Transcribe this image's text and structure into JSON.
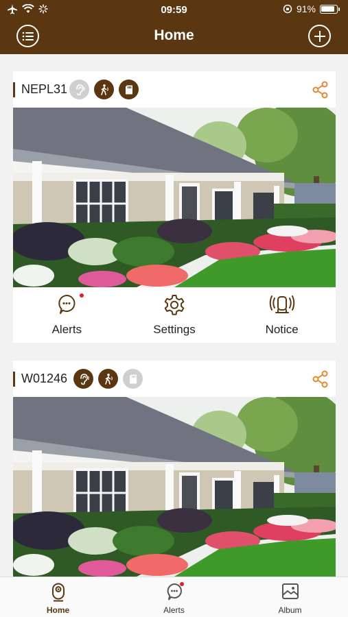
{
  "status_bar": {
    "time": "09:59",
    "battery": "91%"
  },
  "header": {
    "title": "Home"
  },
  "devices": [
    {
      "name": "NEPL31",
      "badges": {
        "sound": "off",
        "motion": "on",
        "storage": "on"
      },
      "actions": [
        {
          "label": "Alerts",
          "icon": "alert-bubble-icon",
          "unread": true
        },
        {
          "label": "Settings",
          "icon": "gear-icon",
          "unread": false
        },
        {
          "label": "Notice",
          "icon": "siren-icon",
          "unread": false
        }
      ]
    },
    {
      "name": "W01246",
      "badges": {
        "sound": "on",
        "motion": "on",
        "storage": "off"
      }
    }
  ],
  "tabbar": [
    {
      "label": "Home",
      "icon": "camera-icon",
      "active": true
    },
    {
      "label": "Alerts",
      "icon": "alert-bubble-icon",
      "unread": true
    },
    {
      "label": "Album",
      "icon": "album-icon",
      "active": false
    }
  ],
  "colors": {
    "brand": "#5a3710",
    "accent": "#e8862e",
    "badge_off": "#cfcfcf",
    "unread": "#e02020"
  }
}
